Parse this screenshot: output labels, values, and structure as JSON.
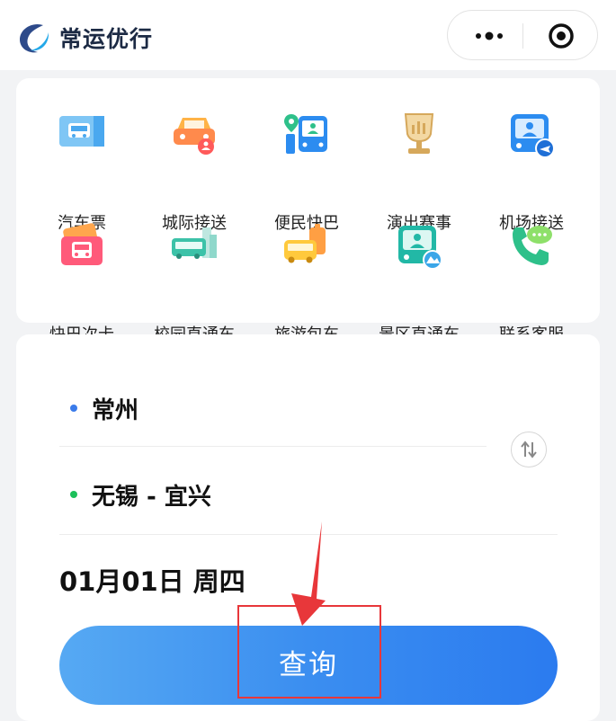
{
  "header": {
    "title": "常运优行",
    "more_icon": "more-dots-icon",
    "target_icon": "target-circle-icon"
  },
  "services": [
    {
      "label": "汽车票",
      "icon": "bus-ticket-icon"
    },
    {
      "label": "城际接送",
      "icon": "car-pickup-icon"
    },
    {
      "label": "便民快巴",
      "icon": "location-bus-icon"
    },
    {
      "label": "演出赛事",
      "icon": "trophy-icon"
    },
    {
      "label": "机场接送",
      "icon": "airport-bus-icon"
    },
    {
      "label": "快巴次卡",
      "icon": "bus-card-icon"
    },
    {
      "label": "校园直通车",
      "icon": "campus-bus-icon"
    },
    {
      "label": "旅游包车",
      "icon": "tour-bus-icon"
    },
    {
      "label": "景区直通车",
      "icon": "scenic-bus-icon"
    },
    {
      "label": "联系客服",
      "icon": "phone-chat-icon"
    }
  ],
  "search": {
    "from_city": "常州",
    "to_city": "无锡 - 宜兴",
    "date": "01月01日 周四",
    "query_label": "查询"
  },
  "colors": {
    "accent": "#2b7bef",
    "from_dot": "#3a7bea",
    "to_dot": "#1cc05a",
    "annotation": "#e8373a"
  }
}
